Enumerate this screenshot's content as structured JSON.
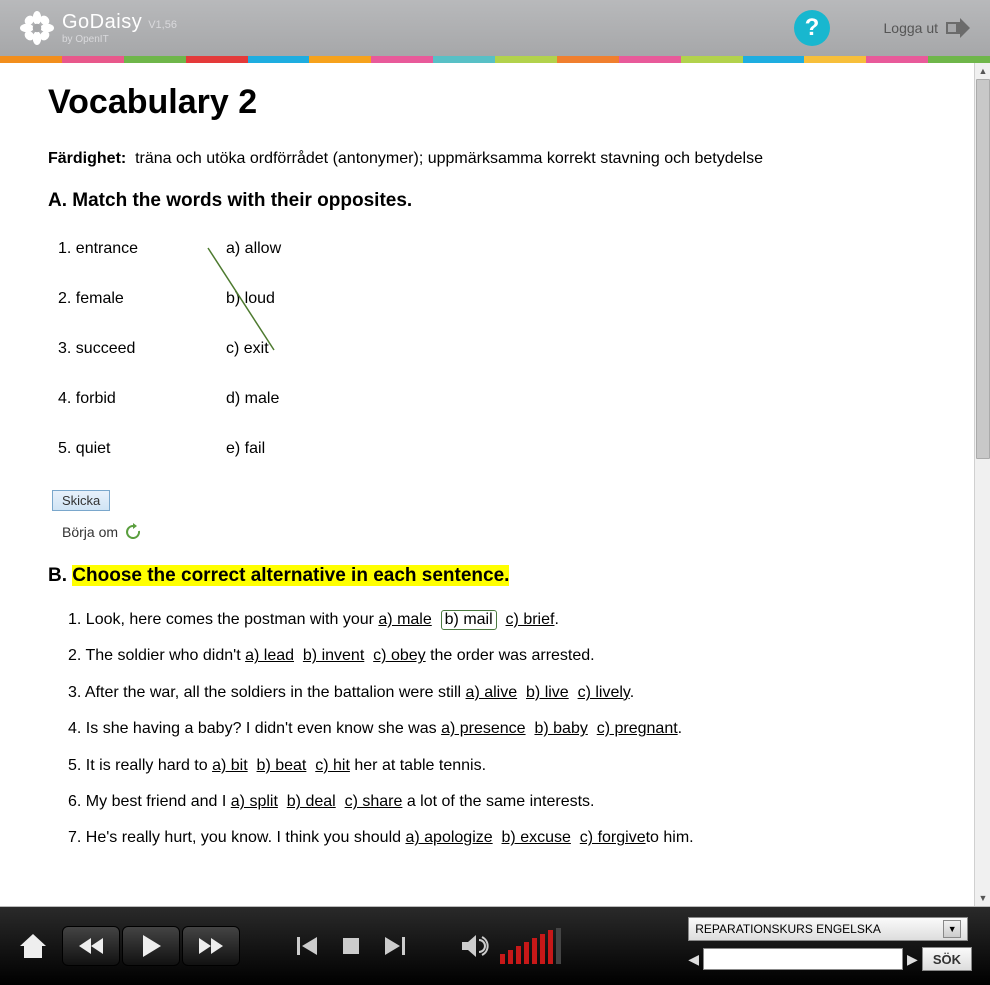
{
  "header": {
    "app_name": "GoDaisy",
    "version": "V1,56",
    "byline": "by OpenIT",
    "help_label": "?",
    "logout_label": "Logga ut"
  },
  "rainbow": [
    "#f28e1c",
    "#e8588b",
    "#6fb64a",
    "#e43a3a",
    "#1eade0",
    "#f6a21c",
    "#e85a9a",
    "#58c0c6",
    "#b2d24c",
    "#f07f2e",
    "#e85a9a",
    "#b2d24c",
    "#1eade0",
    "#f7bf3b",
    "#e85a9a",
    "#6fb64a"
  ],
  "content": {
    "title": "Vocabulary 2",
    "skill_label": "Färdighet:",
    "skill_text": "träna och utöka ordförrådet (antonymer); uppmärksamma korrekt stavning och betydelse",
    "section_a_title": "A. Match the words with their opposites.",
    "matches": {
      "left": [
        "1. entrance",
        "2. female",
        "3. succeed",
        "4. forbid",
        "5. quiet"
      ],
      "right": [
        "a) allow",
        "b) loud",
        "c) exit",
        "d) male",
        "e) fail"
      ]
    },
    "submit_label": "Skicka",
    "restart_label": "Börja om",
    "section_b_prefix": "B. ",
    "section_b_title": "Choose the correct alternative in each sentence.",
    "sentences": [
      {
        "n": "1.",
        "pre": "Look, here comes the postman with your ",
        "alts": [
          "a) male",
          "b) mail",
          "c) brief"
        ],
        "sel": 1,
        "post": "."
      },
      {
        "n": "2.",
        "pre": "The soldier who didn't ",
        "alts": [
          "a) lead",
          "b) invent",
          "c) obey"
        ],
        "sel": -1,
        "post": " the order was arrested."
      },
      {
        "n": "3.",
        "pre": "After the war, all the soldiers in the battalion were still ",
        "alts": [
          "a) alive",
          "b) live",
          "c) lively"
        ],
        "sel": -1,
        "post": "."
      },
      {
        "n": "4.",
        "pre": "Is she having a baby? I didn't even know she was ",
        "alts": [
          "a) presence",
          "b) baby",
          "c) pregnant"
        ],
        "sel": -1,
        "post": "."
      },
      {
        "n": "5.",
        "pre": "It is really hard to ",
        "alts": [
          "a) bit",
          "b) beat",
          "c) hit"
        ],
        "sel": -1,
        "post": " her at table tennis."
      },
      {
        "n": "6.",
        "pre": "My best friend and I ",
        "alts": [
          "a) split",
          "b) deal",
          "c) share"
        ],
        "sel": -1,
        "post": " a lot of the same interests."
      },
      {
        "n": "7.",
        "pre": "He's really hurt, you know. I think you should ",
        "alts": [
          "a) apologize",
          "b) excuse",
          "c) forgive"
        ],
        "sel": -1,
        "post": "to him."
      }
    ]
  },
  "player": {
    "dropdown": "REPARATIONSKURS ENGELSKA",
    "search_placeholder": "",
    "search_button": "SÖK"
  }
}
